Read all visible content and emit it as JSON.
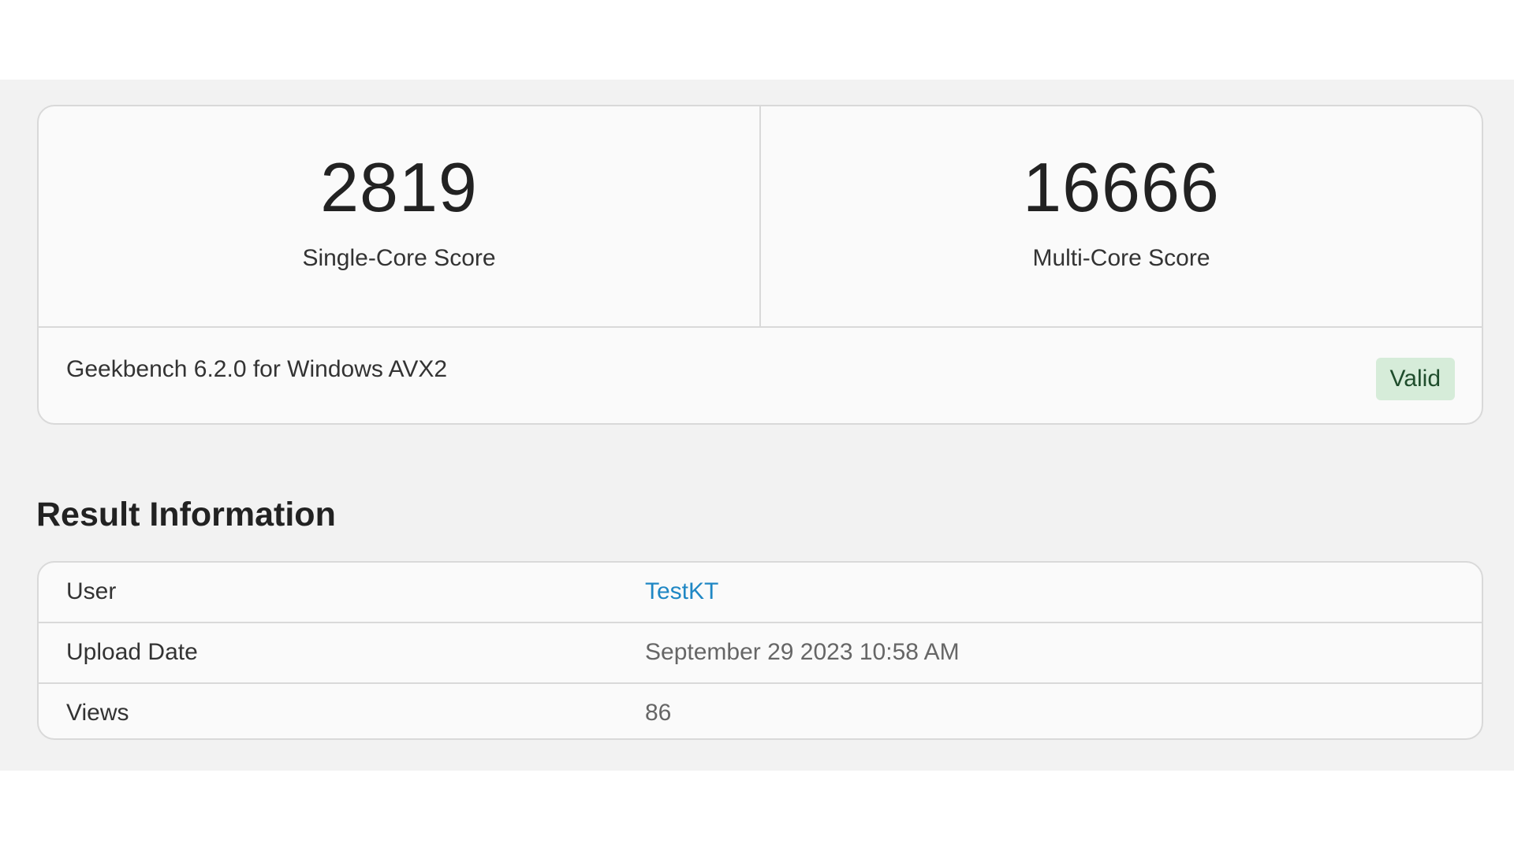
{
  "scores": {
    "single": {
      "value": "2819",
      "label": "Single-Core Score"
    },
    "multi": {
      "value": "16666",
      "label": "Multi-Core Score"
    }
  },
  "version": {
    "text": "Geekbench 6.2.0 for Windows AVX2",
    "badge": "Valid"
  },
  "result_info": {
    "title": "Result Information",
    "rows": [
      {
        "key": "User",
        "value": "TestKT"
      },
      {
        "key": "Upload Date",
        "value": "September 29 2023 10:58 AM"
      },
      {
        "key": "Views",
        "value": "86"
      }
    ]
  },
  "colors": {
    "link": "#1f87c4",
    "badge_bg": "#d6ecd9",
    "band_bg": "#f2f2f2"
  }
}
